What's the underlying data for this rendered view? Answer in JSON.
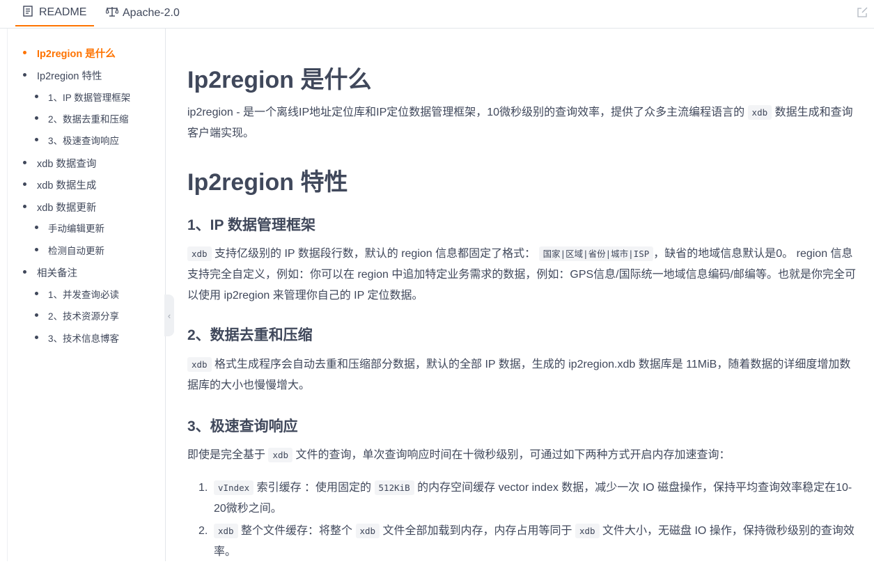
{
  "tabs": [
    {
      "label": "README",
      "icon": "readme-icon"
    },
    {
      "label": "Apache-2.0",
      "icon": "scale-icon"
    }
  ],
  "toc": [
    {
      "label": "Ip2region 是什么",
      "level": 1,
      "active": true
    },
    {
      "label": "Ip2region 特性",
      "level": 1
    },
    {
      "label": "1、IP 数据管理框架",
      "level": 2
    },
    {
      "label": "2、数据去重和压缩",
      "level": 2
    },
    {
      "label": "3、极速查询响应",
      "level": 2
    },
    {
      "label": "xdb 数据查询",
      "level": 1
    },
    {
      "label": "xdb 数据生成",
      "level": 1
    },
    {
      "label": "xdb 数据更新",
      "level": 1
    },
    {
      "label": "手动编辑更新",
      "level": 2
    },
    {
      "label": "检测自动更新",
      "level": 2
    },
    {
      "label": "相关备注",
      "level": 1
    },
    {
      "label": "1、并发查询必读",
      "level": 2
    },
    {
      "label": "2、技术资源分享",
      "level": 2
    },
    {
      "label": "3、技术信息博客",
      "level": 2
    }
  ],
  "content": {
    "h1_what": "Ip2region 是什么",
    "p_what_a": "ip2region - 是一个离线IP地址定位库和IP定位数据管理框架，10微秒级别的查询效率，提供了众多主流编程语言的",
    "p_what_code": "xdb",
    "p_what_b": "数据生成和查询客户端实现。",
    "h1_features": "Ip2region 特性",
    "h3_f1": "1、IP 数据管理框架",
    "f1_code1": "xdb",
    "f1_a": "支持亿级别的 IP 数据段行数，默认的 region 信息都固定了格式：",
    "f1_code2": "国家|区域|省份|城市|ISP",
    "f1_b": "，缺省的地域信息默认是0。 region 信息支持完全自定义，例如：你可以在 region 中追加特定业务需求的数据，例如：GPS信息/国际统一地域信息编码/邮编等。也就是你完全可以使用 ip2region 来管理你自己的 IP 定位数据。",
    "h3_f2": "2、数据去重和压缩",
    "f2_code": "xdb",
    "f2_a": "格式生成程序会自动去重和压缩部分数据，默认的全部 IP 数据，生成的 ip2region.xdb 数据库是 11MiB，随着数据的详细度增加数据库的大小也慢慢增大。",
    "h3_f3": "3、极速查询响应",
    "f3_a": "即使是完全基于",
    "f3_code": "xdb",
    "f3_b": "文件的查询，单次查询响应时间在十微秒级别，可通过如下两种方式开启内存加速查询：",
    "li1_num": "1.",
    "li1_code1": "vIndex",
    "li1_a": "索引缓存 ：使用固定的",
    "li1_code2": "512KiB",
    "li1_b": "的内存空间缓存 vector index 数据，减少一次 IO 磁盘操作，保持平均查询效率稳定在10-20微秒之间。",
    "li2_num": "2.",
    "li2_code1": "xdb",
    "li2_a": "整个文件缓存：将整个",
    "li2_code2": "xdb",
    "li2_b": "文件全部加载到内存，内存占用等同于",
    "li2_code3": "xdb",
    "li2_c": "文件大小，无磁盘 IO 操作，保持微秒级别的查询效率。"
  },
  "colors": {
    "accent": "#fe7300",
    "text": "#40485b",
    "border": "#e3e6ea"
  }
}
